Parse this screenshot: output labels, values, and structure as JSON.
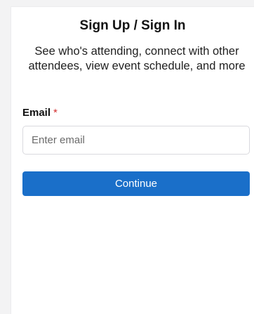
{
  "auth": {
    "title": "Sign Up / Sign In",
    "subtitle": "See who's attending, connect with other attendees, view event schedule, and more",
    "email_label": "Email",
    "required_marker": "*",
    "email_placeholder": "Enter email",
    "email_value": "",
    "continue_label": "Continue"
  },
  "colors": {
    "accent": "#1a6fc9",
    "required": "#d32f2f",
    "background": "#f3f3f4"
  }
}
